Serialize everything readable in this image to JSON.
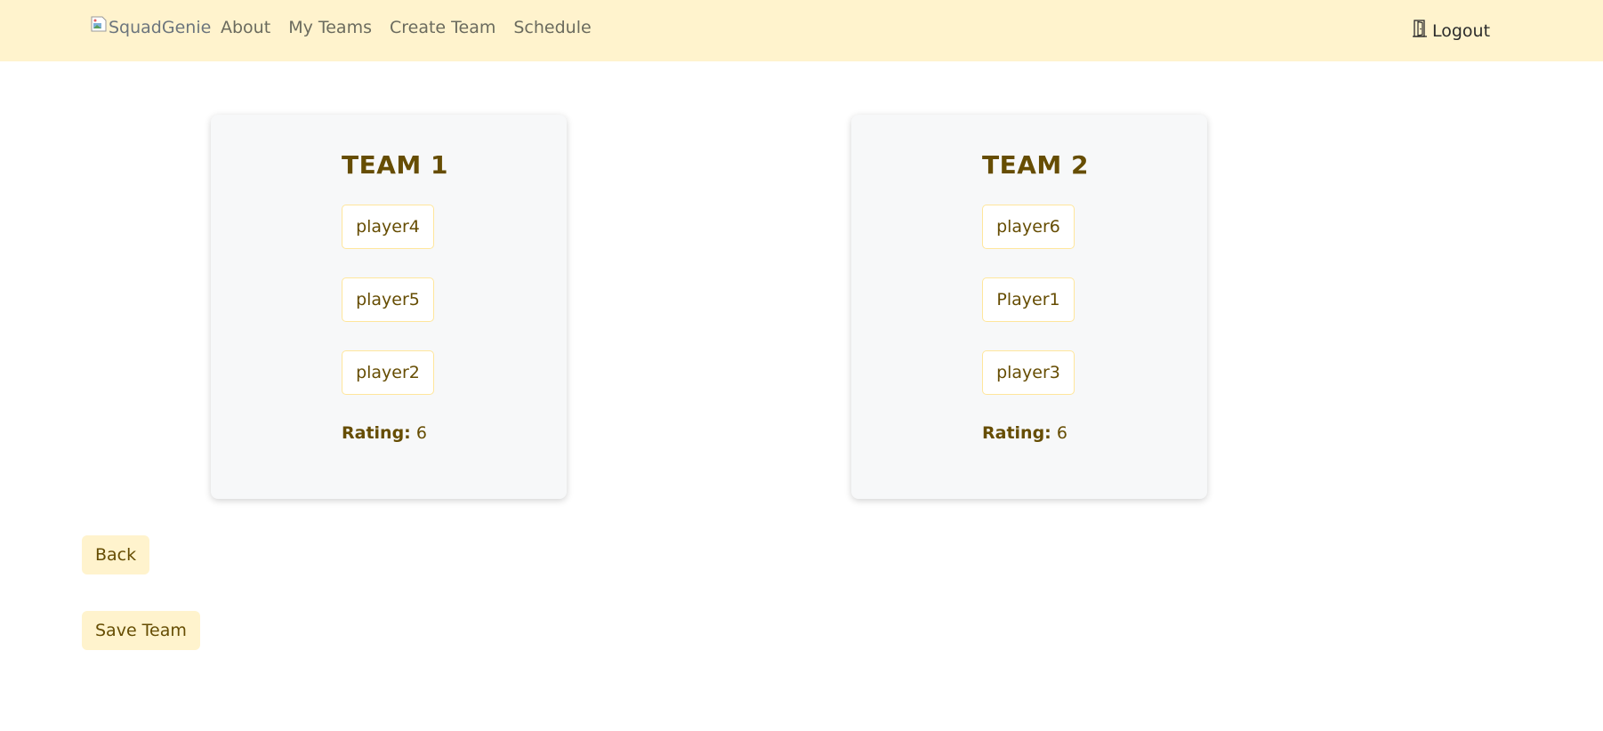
{
  "navbar": {
    "brand_alt": "SquadGenie",
    "links": [
      "About",
      "My Teams",
      "Create Team",
      "Schedule"
    ],
    "logout_label": "Logout"
  },
  "teams": [
    {
      "title": "TEAM 1",
      "players": [
        "player4",
        "player5",
        "player2"
      ],
      "rating_label": "Rating:",
      "rating_value": "6"
    },
    {
      "title": "TEAM 2",
      "players": [
        "player6",
        "Player1",
        "player3"
      ],
      "rating_label": "Rating:",
      "rating_value": "6"
    }
  ],
  "actions": {
    "back_label": "Back",
    "save_label": "Save Team"
  },
  "colors": {
    "navbar_bg": "#fff3cd",
    "accent_text": "#664d03",
    "player_border": "#ffe69c",
    "card_bg": "#f7f8f9"
  },
  "icons": {
    "brand": "broken-image-icon",
    "logout": "door-icon"
  }
}
